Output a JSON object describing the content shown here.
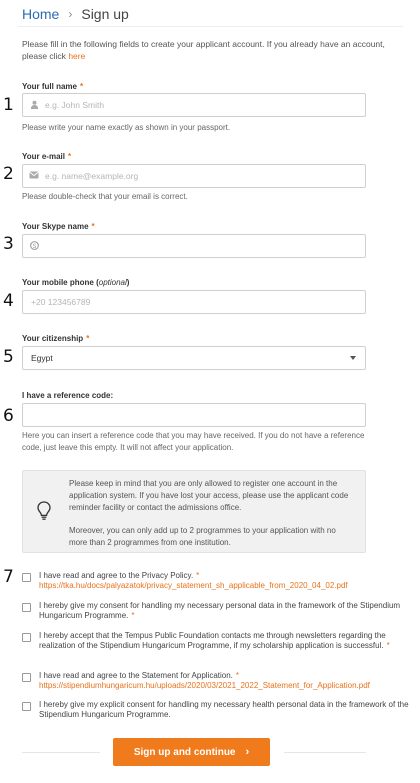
{
  "breadcrumb": {
    "home": "Home",
    "separator": "›",
    "current": "Sign up"
  },
  "intro": {
    "text": "Please fill in the following fields to create your applicant account. If you already have an account, please click ",
    "link": "here"
  },
  "steps": [
    "1",
    "2",
    "3",
    "4",
    "5",
    "6",
    "7"
  ],
  "required_mark": "*",
  "fields": {
    "full_name": {
      "label": "Your full name",
      "placeholder": "e.g. John Smith",
      "help": "Please write your name exactly as shown in your passport.",
      "icon": "user-icon"
    },
    "email": {
      "label": "Your e-mail",
      "placeholder": "e.g. name@example.org",
      "help": "Please double-check that your email is correct.",
      "icon": "envelope-icon"
    },
    "skype": {
      "label": "Your Skype name",
      "value": "",
      "icon": "skype-icon"
    },
    "phone": {
      "label_main": "Your mobile phone (",
      "label_optional": "optional",
      "label_end": ")",
      "placeholder": "+20 123456789"
    },
    "citizenship": {
      "label": "Your citizenship",
      "value": "Egypt"
    },
    "reference": {
      "label": "I have a reference code:",
      "value": "",
      "help": "Here you can insert a reference code that you may have received. If you do not have a reference code, just leave this empty. It will not affect your application."
    }
  },
  "notice": {
    "icon": "lightbulb-icon",
    "p1": "Please keep in mind that you are only allowed to register one account in the application system. If you have lost your access, please use the applicant code reminder facility or contact the admissions office.",
    "p2": "Moreover, you can only add up to 2 programmes to your application with no more than 2 programmes from one institution."
  },
  "consents": [
    {
      "text": "I have read and agree to the Privacy Policy.",
      "link": "https://tka.hu/docs/palyazatok/privacy_statement_sh_applicable_from_2020_04_02.pdf",
      "checked": false
    },
    {
      "text": "I hereby give my consent for handling my necessary personal data in the framework of the Stipendium Hungaricum Programme.",
      "checked": false
    },
    {
      "text": "I hereby accept that the Tempus Public Foundation contacts me through newsletters regarding the realization of the Stipendium Hungaricum Programme, if my scholarship application is successful.",
      "checked": false
    },
    {
      "text": "I have read and agree to the Statement for Application.",
      "link": "https://stipendiumhungaricum.hu/uploads/2020/03/2021_2022_Statement_for_Application.pdf",
      "checked": false
    },
    {
      "text": "I hereby give my explicit consent for handling my necessary health personal data in the framework of the Stipendium Hungaricum Programme.",
      "checked": false
    }
  ],
  "submit": {
    "label": "Sign up and continue",
    "arrow": "›"
  },
  "colors": {
    "accent": "#f07b1d",
    "link": "#e8721c",
    "breadcrumb_link": "#2b6cb0"
  }
}
